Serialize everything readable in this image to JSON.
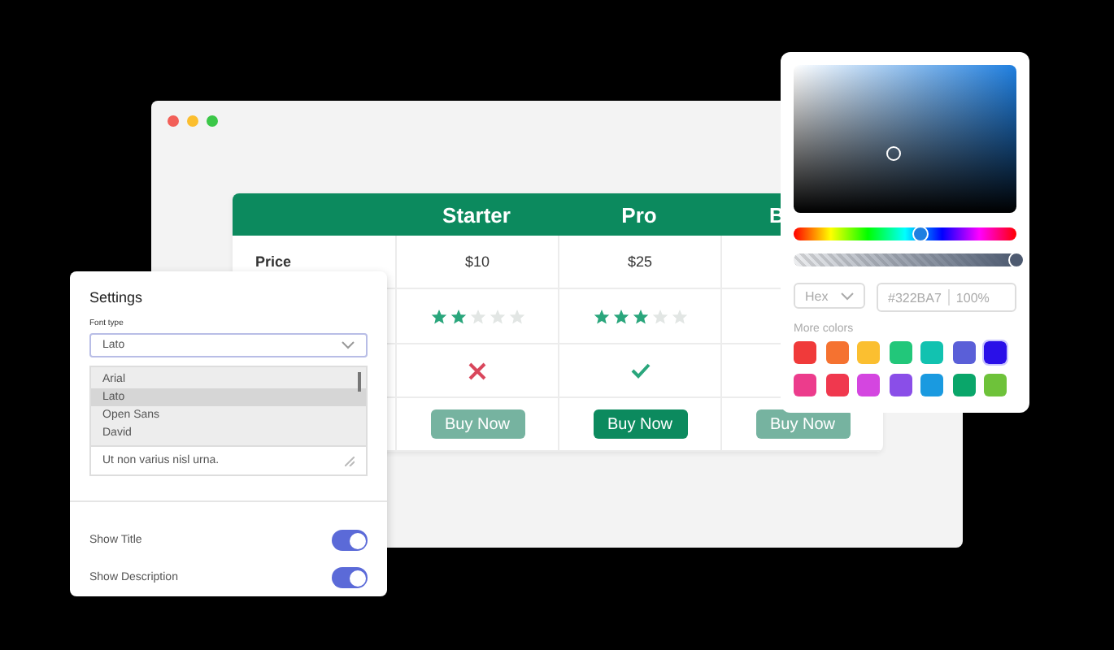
{
  "browser": {
    "dots": [
      {
        "color": "#f25f58"
      },
      {
        "color": "#fbbe2e"
      },
      {
        "color": "#3bc748"
      }
    ]
  },
  "pricing_table": {
    "row_labels": [
      "Price"
    ],
    "plans": [
      {
        "name": "Starter",
        "price": "$10",
        "stars": 2,
        "included": false,
        "button": "Buy Now",
        "highlighted": false
      },
      {
        "name": "Pro",
        "price": "$25",
        "stars": 3,
        "included": true,
        "button": "Buy Now",
        "highlighted": true
      },
      {
        "name": "B",
        "button": "Buy Now",
        "highlighted": false
      }
    ]
  },
  "settings": {
    "title": "Settings",
    "font_label": "Font type",
    "font_select": {
      "value": "Lato"
    },
    "font_options": [
      {
        "label": "Arial",
        "selected": false
      },
      {
        "label": "Lato",
        "selected": true
      },
      {
        "label": "Open Sans",
        "selected": false
      },
      {
        "label": "David",
        "selected": false
      }
    ],
    "textarea": {
      "value": "Ut non varius nisl urna."
    },
    "toggles": [
      {
        "label": "Show Title",
        "on": true
      },
      {
        "label": "Show Description",
        "on": true
      }
    ]
  },
  "color_picker": {
    "hue": {
      "level": 0.57
    },
    "alpha": {
      "level": 1
    },
    "format": "Hex",
    "hex": "#322BA7",
    "opacity": "100%",
    "more_colors_label": "More colors",
    "swatches": [
      {
        "color": "#f03a3a",
        "selected": false
      },
      {
        "color": "#f57230",
        "selected": false
      },
      {
        "color": "#fbbf30",
        "selected": false
      },
      {
        "color": "#22c77a",
        "selected": false
      },
      {
        "color": "#12c2b0",
        "selected": false
      },
      {
        "color": "#5a5fd8",
        "selected": false
      },
      {
        "color": "#2a10e8",
        "selected": true
      },
      {
        "color": "#ec3c8c",
        "selected": false
      },
      {
        "color": "#f0384e",
        "selected": false
      },
      {
        "color": "#d446e0",
        "selected": false
      },
      {
        "color": "#8a4ee8",
        "selected": false
      },
      {
        "color": "#1a9ae0",
        "selected": false
      },
      {
        "color": "#0aa66a",
        "selected": false
      },
      {
        "color": "#6ec23a",
        "selected": false
      }
    ]
  }
}
